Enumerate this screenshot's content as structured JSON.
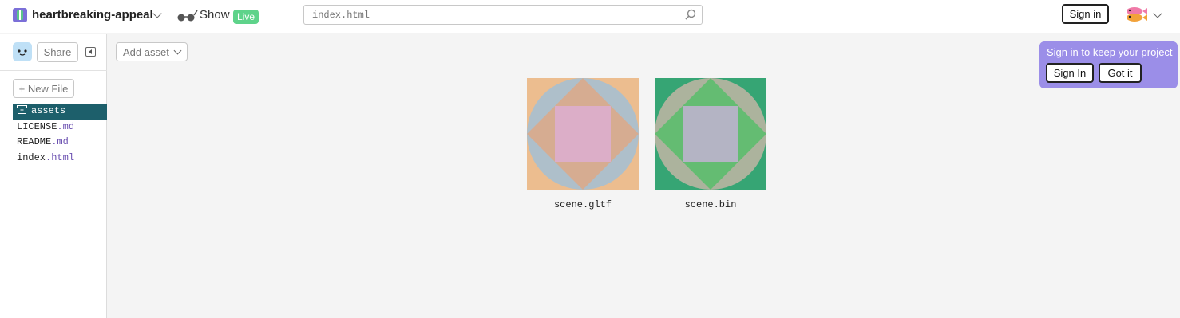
{
  "header": {
    "project_name": "heartbreaking-appeal",
    "show_label": "Show",
    "live_badge": "Live",
    "search_placeholder": "index.html",
    "signin_label": "Sign in"
  },
  "sidebar": {
    "share_label": "Share",
    "new_file_label": "+ New File",
    "files": [
      {
        "name": "assets",
        "ext": ""
      },
      {
        "name": "LICENSE",
        "ext": ".md"
      },
      {
        "name": "README",
        "ext": ".md"
      },
      {
        "name": "index",
        "ext": ".html"
      }
    ]
  },
  "main": {
    "add_asset_label": "Add asset",
    "assets": [
      {
        "name": "scene.gltf"
      },
      {
        "name": "scene.bin"
      }
    ]
  },
  "toast": {
    "title": "Sign in to keep your project",
    "signin_label": "Sign In",
    "dismiss_label": "Got it"
  },
  "colors": {
    "selected_bg": "#1d5f6b",
    "live_badge": "#5ed38a",
    "toast_bg": "#9b8ee8",
    "asset1_bg": "#ecbd8f",
    "asset2_bg": "#36a574"
  }
}
